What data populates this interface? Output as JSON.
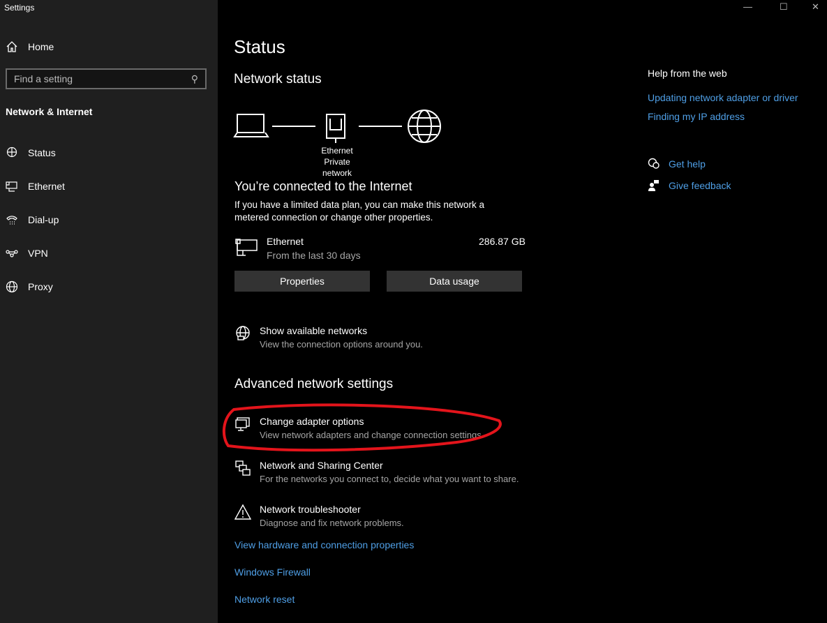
{
  "window": {
    "title": "Settings",
    "min": "—",
    "max": "☐",
    "close": "✕"
  },
  "sidebar": {
    "home": "Home",
    "search_placeholder": "Find a setting",
    "section": "Network & Internet",
    "items": [
      {
        "label": "Status"
      },
      {
        "label": "Ethernet"
      },
      {
        "label": "Dial-up"
      },
      {
        "label": "VPN"
      },
      {
        "label": "Proxy"
      }
    ]
  },
  "main": {
    "title": "Status",
    "network_status": "Network status",
    "diagram_label1": "Ethernet",
    "diagram_label2": "Private network",
    "connected": "You’re connected to the Internet",
    "connected_desc1": "If you have a limited data plan, you can make this network a",
    "connected_desc2": "metered connection or change other properties.",
    "adapter_name": "Ethernet",
    "adapter_sub": "From the last 30 days",
    "usage": "286.87 GB",
    "properties": "Properties",
    "data_usage": "Data usage",
    "show_networks": "Show available networks",
    "show_networks_desc": "View the connection options around you.",
    "advanced": "Advanced network settings",
    "adv_items": [
      {
        "title": "Change adapter options",
        "desc": "View network adapters and change connection settings."
      },
      {
        "title": "Network and Sharing Center",
        "desc": "For the networks you connect to, decide what you want to share."
      },
      {
        "title": "Network troubleshooter",
        "desc": "Diagnose and fix network problems."
      }
    ],
    "links": [
      "View hardware and connection properties",
      "Windows Firewall",
      "Network reset"
    ]
  },
  "help": {
    "title": "Help from the web",
    "links": [
      "Updating network adapter or driver",
      "Finding my IP address"
    ],
    "get_help": "Get help",
    "feedback": "Give feedback"
  },
  "colors": {
    "link": "#4f9fe6",
    "annotation": "#e3141b"
  }
}
